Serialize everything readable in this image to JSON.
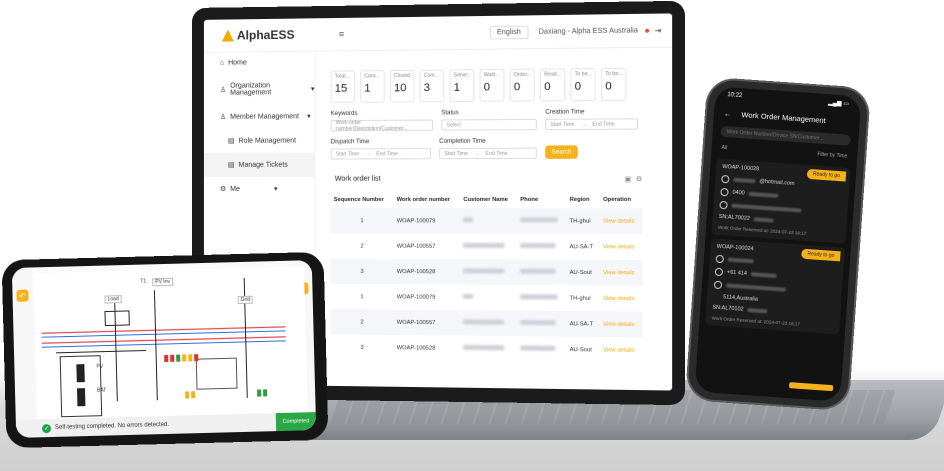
{
  "laptop": {
    "logo": "AlphaESS",
    "menu_icon": "≡",
    "language": "English",
    "user": "Daxiang - Alpha ESS Australia",
    "sidebar": [
      {
        "label": "Home",
        "icon": "home-icon"
      },
      {
        "label": "Organization Management",
        "icon": "org-icon"
      },
      {
        "label": "Member Management",
        "icon": "member-icon"
      },
      {
        "label": "Role Management",
        "icon": "role-icon"
      },
      {
        "label": "Manage Tickets",
        "icon": "ticket-icon"
      },
      {
        "label": "Me",
        "icon": "gear-icon"
      }
    ],
    "stats": [
      {
        "label": "Total...",
        "value": "15"
      },
      {
        "label": "Canc...",
        "value": "1"
      },
      {
        "label": "Closed",
        "value": "10"
      },
      {
        "label": "Com...",
        "value": "3"
      },
      {
        "label": "Serve...",
        "value": "1"
      },
      {
        "label": "Waiti...",
        "value": "0"
      },
      {
        "label": "Order...",
        "value": "0"
      },
      {
        "label": "Read...",
        "value": "0"
      },
      {
        "label": "To be...",
        "value": "0"
      },
      {
        "label": "To be...",
        "value": "0"
      }
    ],
    "filters": {
      "keywords_label": "Keywords",
      "keywords_placeholder": "Work order number/Description/Customer...",
      "status_label": "Status",
      "status_placeholder": "Select",
      "creation_label": "Creation Time",
      "dispatch_label": "Dispatch Time",
      "completion_label": "Completion Time",
      "start_time": "Start Time",
      "end_time": "End Time",
      "search_button": "Search"
    },
    "list_title": "Work order list",
    "table_headers": [
      "Sequence Number",
      "Work order number",
      "Customer Name",
      "Phone",
      "Region",
      "Operation"
    ],
    "rows": [
      {
        "seq": "1",
        "wo": "WOAP-100079",
        "region": "TH-ghui",
        "op": "View details"
      },
      {
        "seq": "2",
        "wo": "WOAP-100557",
        "region": "AU-SA-T",
        "op": "View details"
      },
      {
        "seq": "3",
        "wo": "WOAP-100528",
        "region": "AU-Sout",
        "op": "View details"
      },
      {
        "seq": "1",
        "wo": "WOAP-100079",
        "region": "TH-ghui",
        "op": "View details"
      },
      {
        "seq": "2",
        "wo": "WOAP-100557",
        "region": "AU-SA-T",
        "op": "View details"
      },
      {
        "seq": "3",
        "wo": "WOAP-100528",
        "region": "AU-Sout",
        "op": "View details"
      }
    ]
  },
  "tablet": {
    "status_text": "Self-testing completed. No errors detected.",
    "completed_button": "Completed",
    "labels": {
      "load": "Load",
      "grid": "Grid",
      "pv": "PV",
      "bat": "BAT",
      "t1": "T1",
      "pvinv": "PV Inv"
    }
  },
  "phone": {
    "time": "10:22",
    "title": "Work Order Management",
    "search_placeholder": "Work Order Number/Device SN/Customer...",
    "filter_all": "All",
    "filter_time": "Filter by Time",
    "cards": [
      {
        "id": "WOAP-100028",
        "badge": "Ready to go",
        "email_suffix": "@hotmail.com",
        "phone_prefix": "0400",
        "sn_prefix": "SN:AL70022",
        "foot": "Work Order Reserved at: 2024-07-23 16:17"
      },
      {
        "id": "WOAP-100024",
        "badge": "Ready to go",
        "email_suffix": "",
        "phone_prefix": "+61 414",
        "addr_suffix": "5114,Australia",
        "sn_prefix": "SN:AL70102",
        "foot": "Work Order Reserved at: 2024-07-23 16:17"
      }
    ]
  },
  "colors": {
    "accent": "#f5b21b",
    "success": "#2aa845"
  }
}
